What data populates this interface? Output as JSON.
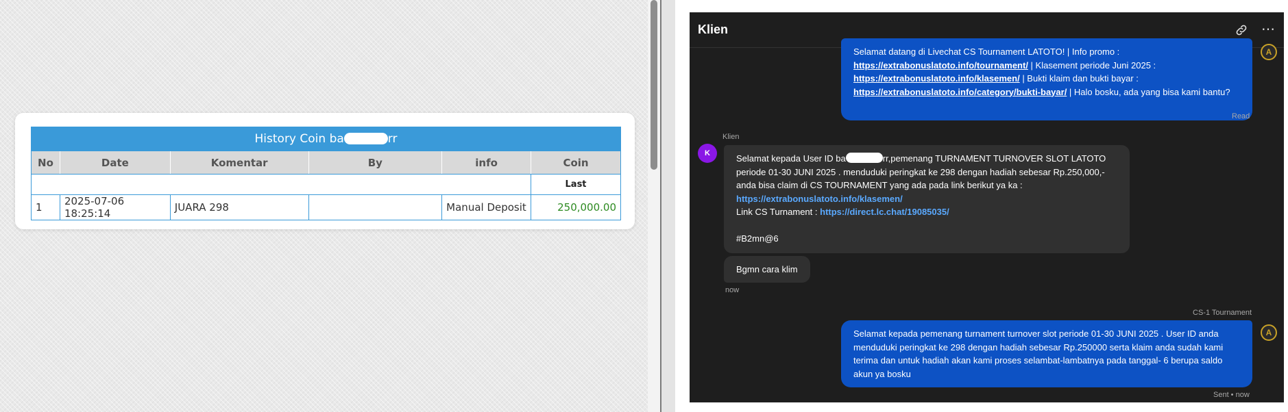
{
  "history": {
    "title_prefix": "History Coin ba",
    "title_suffix": "rr",
    "columns": [
      "No",
      "Date",
      "Komentar",
      "By",
      "info",
      "Coin"
    ],
    "last_label": "Last",
    "row": {
      "no": "1",
      "date": "2025-07-06 18:25:14",
      "komentar": "JUARA 298",
      "by": "",
      "info": "Manual Deposit",
      "coin": "250,000.00"
    }
  },
  "chat": {
    "title": "Klien",
    "agent_avatar_letter": "A",
    "user_avatar_letter": "K",
    "msg1": {
      "line1": "Selamat datang di Livechat CS Tournament LATOTO! | Info promo :",
      "link1": "https://extrabonuslatoto.info/tournament/",
      "after_link1": " | Klasement periode Juni 2025 :",
      "link2": "https://extrabonuslatoto.info/klasemen/",
      "after_link2": " | Bukti klaim dan bukti bayar :",
      "link3": "https://extrabonuslatoto.info/category/bukti-bayar/",
      "after_link3": " | Halo bosku, ada yang bisa kami bantu?",
      "status": "Read"
    },
    "sender_label": "Klien",
    "msg2": {
      "line1_prefix": "Selamat kepada User ID ba",
      "line1_suffix": "rr,pemenang TURNAMENT TURNOVER SLOT LATOTO",
      "line2": "periode 01-30 JUNI 2025 . menduduki peringkat ke 298 dengan hadiah sebesar Rp.250,000,-",
      "line3": "anda bisa claim di CS TOURNAMENT yang ada pada link berikut ya ka :",
      "link1": "https://extrabonuslatoto.info/klasemen/",
      "line5_prefix": "Link CS Turnament : ",
      "link2": "https://direct.lc.chat/19085035/",
      "code": "#B2mn@6"
    },
    "msg3": {
      "text": "Bgmn cara klim",
      "time": "now"
    },
    "agent_label": "CS-1 Tournament",
    "msg4": {
      "line1": "Selamat kepada pemenang turnament turnover slot periode 01-30 JUNI 2025 . User ID anda",
      "line2": "menduduki peringkat ke 298 dengan hadiah sebesar Rp.250000 serta klaim anda sudah kami",
      "line3": "terima dan untuk hadiah akan kami proses selambat-lambatnya pada tanggal- 6 berupa saldo",
      "line4": "akun ya bosku",
      "status": "Sent • now"
    },
    "colors": {
      "bubble_out": "#0d52c4",
      "bubble_in": "#303030",
      "background": "#1e1e1e",
      "link": "#5aa9ff"
    }
  }
}
